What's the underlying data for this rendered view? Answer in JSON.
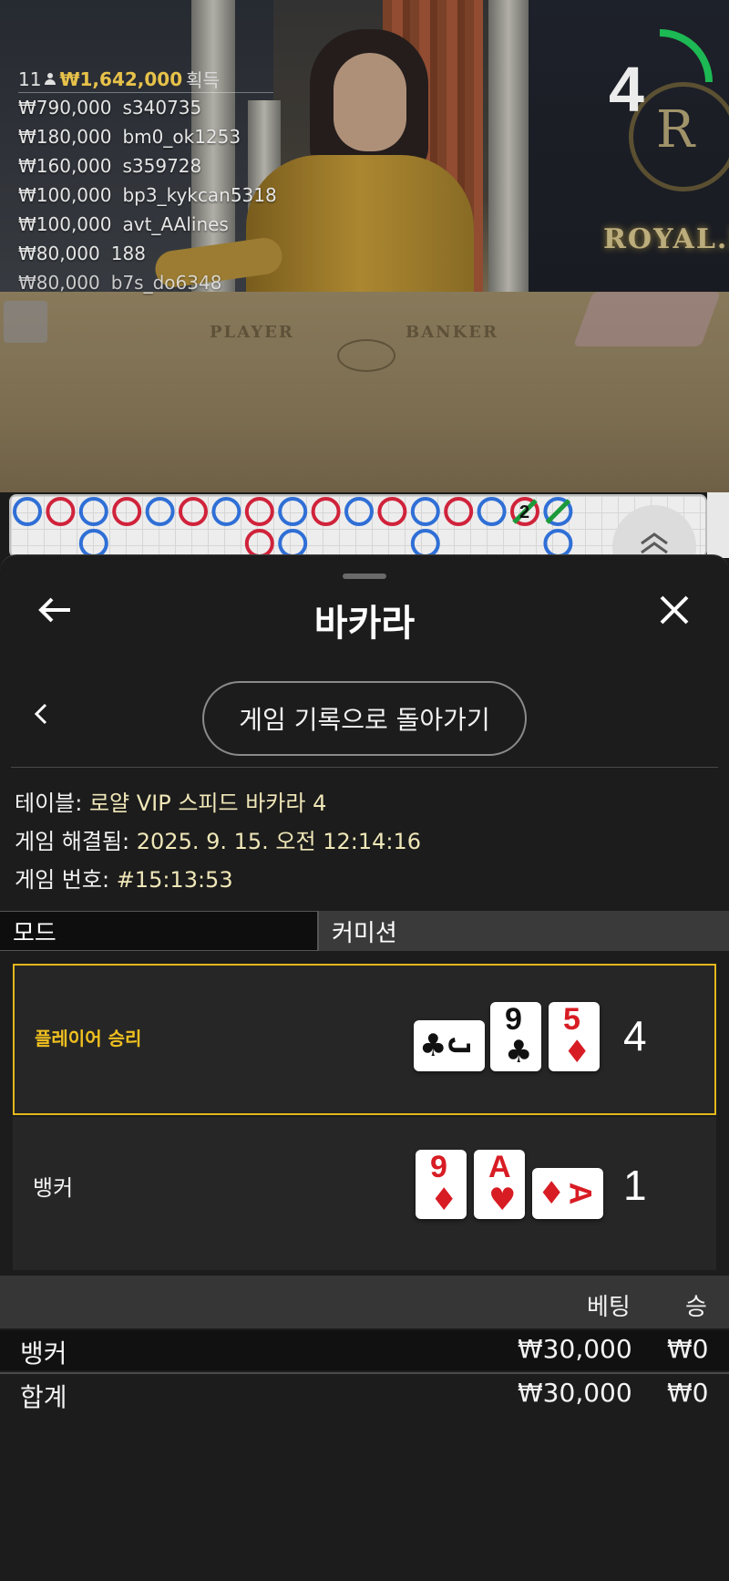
{
  "winners": {
    "count": "11",
    "total": "₩1,642,000",
    "earned_label": "획득",
    "rows": [
      {
        "amount": "₩790,000",
        "user": "s340735"
      },
      {
        "amount": "₩180,000",
        "user": "bm0_ok1253"
      },
      {
        "amount": "₩160,000",
        "user": "s359728"
      },
      {
        "amount": "₩100,000",
        "user": "bp3_kykcan5318"
      },
      {
        "amount": "₩100,000",
        "user": "avt_AAlines"
      },
      {
        "amount": "₩80,000",
        "user": "188"
      },
      {
        "amount": "₩80,000",
        "user": "b7s_do6348"
      }
    ]
  },
  "countdown": {
    "value": "4",
    "fraction_remaining": 0.25,
    "color": "#1db954"
  },
  "table_surface": {
    "player_word": "PLAYER",
    "banker_word": "BANKER",
    "brand": "ROYAL.L"
  },
  "roadmap": {
    "top_row": [
      "B",
      "R",
      "B",
      "R",
      "B",
      "R",
      "B",
      "R",
      "B",
      "R",
      "B",
      "R",
      "B",
      "R",
      "B",
      "R",
      "B"
    ],
    "bottom_row_marks": [
      "B",
      "R",
      "B",
      "B",
      "B"
    ],
    "tie_count": "2",
    "colors": {
      "banker": "#d0233b",
      "player": "#2f6fd6",
      "tie": "#1c9a3a"
    }
  },
  "sheet": {
    "title": "바카라",
    "history_button": "게임 기록으로 돌아가기",
    "table_label": "테이블:",
    "table_value": "로얄 VIP 스피드 바카라 4",
    "resolved_label": "게임 해결됨:",
    "resolved_value": "2025. 9. 15. 오전 12:14:16",
    "game_no_label": "게임 번호:",
    "game_no_value": "#15:13:53",
    "tabs": {
      "mode": "모드",
      "commission": "커미션"
    }
  },
  "hands": {
    "player": {
      "label": "플레이어 승리",
      "score": "4",
      "cards": [
        {
          "rank": "J",
          "suit": "♣",
          "color": "black",
          "sideways": true
        },
        {
          "rank": "9",
          "suit": "♣",
          "color": "black"
        },
        {
          "rank": "5",
          "suit": "♦",
          "color": "red"
        }
      ]
    },
    "banker": {
      "label": "뱅커",
      "score": "1",
      "cards": [
        {
          "rank": "9",
          "suit": "♦",
          "color": "red"
        },
        {
          "rank": "A",
          "suit": "♥",
          "color": "red"
        },
        {
          "rank": "A",
          "suit": "♦",
          "color": "red",
          "sideways": true
        }
      ]
    }
  },
  "bets": {
    "headers": {
      "bet": "베팅",
      "win": "승"
    },
    "rows": [
      {
        "name": "뱅커",
        "bet": "₩30,000",
        "win": "₩0"
      },
      {
        "name": "합계",
        "bet": "₩30,000",
        "win": "₩0"
      }
    ]
  }
}
